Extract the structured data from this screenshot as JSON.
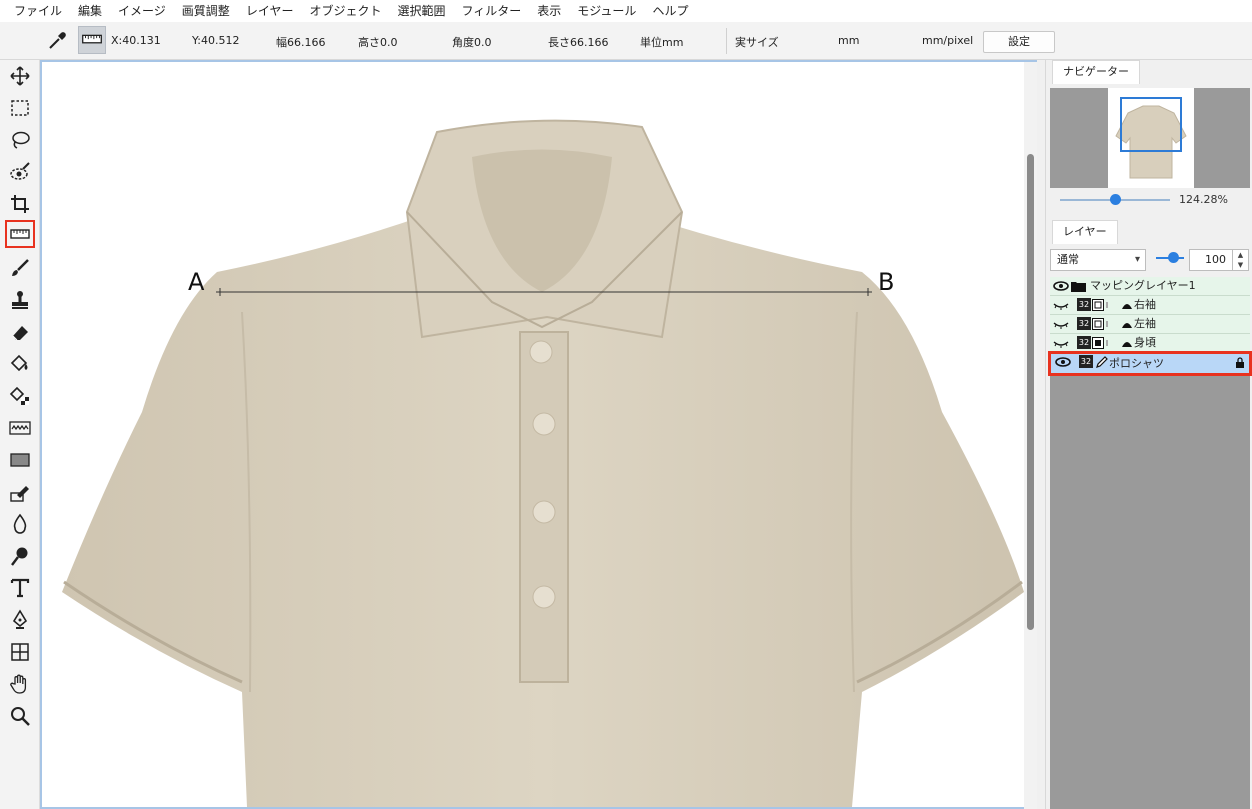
{
  "menu": [
    "ファイル",
    "編集",
    "イメージ",
    "画質調整",
    "レイヤー",
    "オブジェクト",
    "選択範囲",
    "フィルター",
    "表示",
    "モジュール",
    "ヘルプ"
  ],
  "options": {
    "x": "X:40.131",
    "y": "Y:40.512",
    "width": "幅66.166",
    "height": "高さ0.0",
    "angle": "角度0.0",
    "length": "長さ66.166",
    "unit": "単位mm",
    "actual_size_label": "実サイズ",
    "actual_unit": "mm",
    "ratio_unit": "mm/pixel",
    "settings_button": "設定"
  },
  "tools": [
    "move-tool-icon",
    "rect-select-icon",
    "lasso-icon",
    "eye-select-icon",
    "crop-icon",
    "ruler-icon",
    "brush-icon",
    "stamp-icon",
    "eraser-icon",
    "fill-icon",
    "fill-pattern-icon",
    "wave-icon",
    "rectangle-icon",
    "pen-edit-icon",
    "drop-icon",
    "dodge-icon",
    "text-icon",
    "pen-tool-icon",
    "grid-transform-icon",
    "hand-icon",
    "zoom-icon"
  ],
  "active_tool": "ruler-icon",
  "canvas": {
    "point_a": "A",
    "point_b": "B",
    "shirt_color": "#d8cfbc"
  },
  "navigator": {
    "tab": "ナビゲーター",
    "zoom": "124.28%"
  },
  "layers_panel": {
    "tab": "レイヤー",
    "blend_mode": "通常",
    "opacity": "100",
    "rows": [
      {
        "name": "マッピングレイヤー1",
        "badge": ""
      },
      {
        "name": "右袖",
        "badge": "32"
      },
      {
        "name": "左袖",
        "badge": "32"
      },
      {
        "name": "身頃",
        "badge": "32"
      },
      {
        "name": "ポロシャツ",
        "badge": "32"
      }
    ]
  },
  "colors": {
    "highlight": "#e8321f",
    "accent": "#2b7fe0",
    "canvas_border": "#a7c5e6"
  }
}
